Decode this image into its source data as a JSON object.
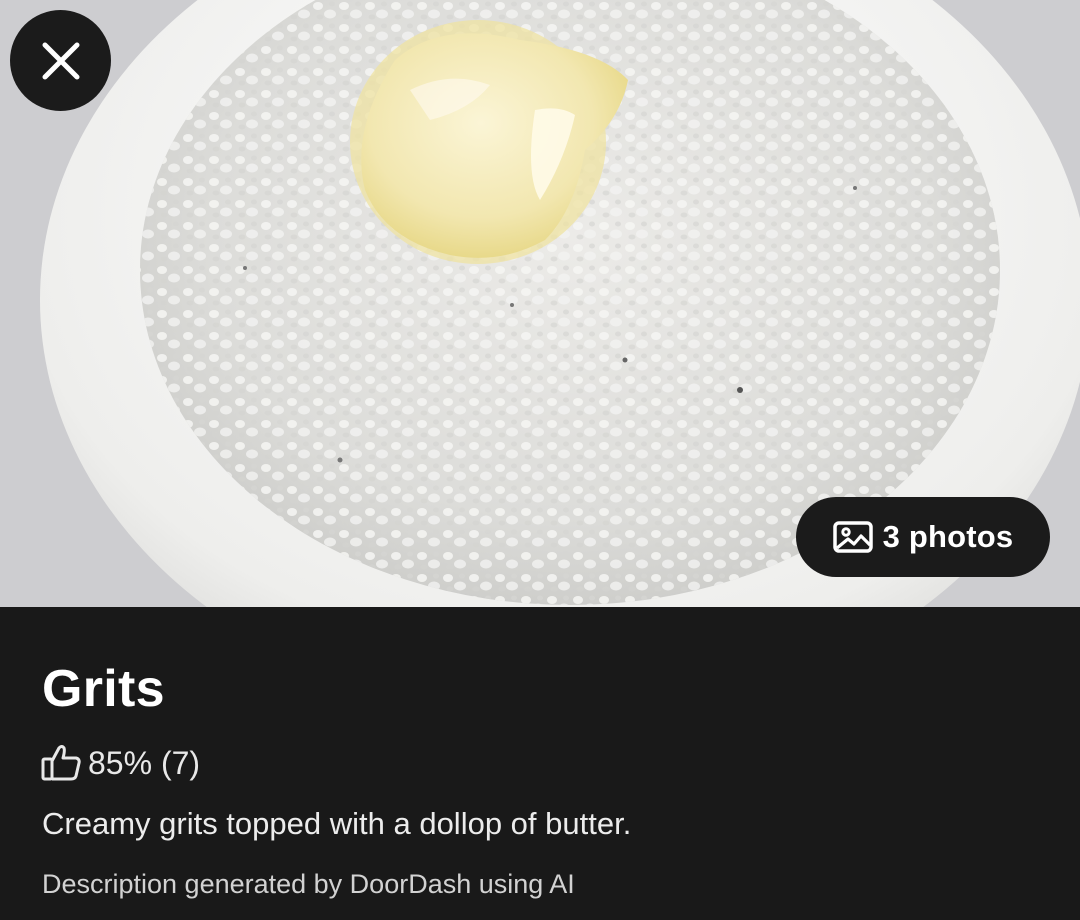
{
  "photo": {
    "subject": "grits-with-butter-photo",
    "colors": {
      "background": "#cfcfd1",
      "bowl": "#f1f1f0",
      "grits": "#e2e2e0",
      "butter": "#f7efc4"
    }
  },
  "close_button": {
    "icon": "close-icon"
  },
  "photos_button": {
    "icon": "image-icon",
    "label": "3 photos"
  },
  "item": {
    "title": "Grits",
    "rating": {
      "icon": "thumbs-up-icon",
      "text": "85% (7)",
      "percent": 85,
      "count": 7
    },
    "description": "Creamy grits topped with a dollop of butter.",
    "ai_note": "Description generated by DoorDash using AI"
  },
  "theme": {
    "panel_background": "#191919",
    "text": "#ffffff"
  }
}
